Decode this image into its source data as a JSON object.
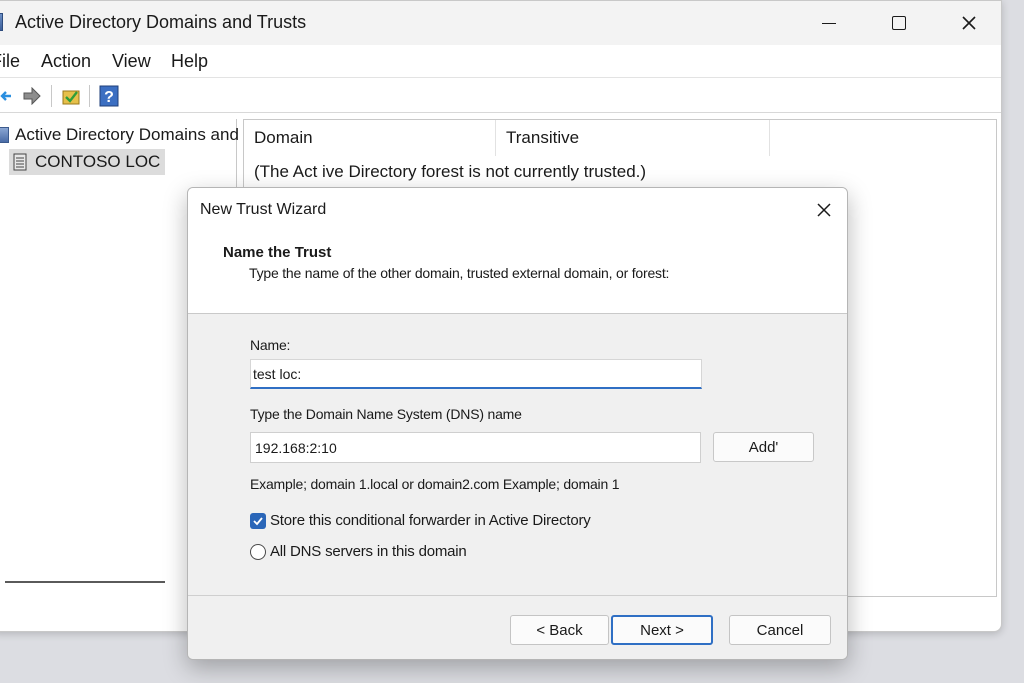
{
  "window": {
    "title": "Active Directory Domains and Trusts"
  },
  "menu": {
    "items": [
      "File",
      "Action",
      "View",
      "Help"
    ]
  },
  "tree": {
    "root_label": "Active Directory Domains and",
    "child_label": "CONTOSO LOC"
  },
  "list": {
    "columns": [
      "Domain",
      "Transitive"
    ],
    "empty_message": "(The Act ive Directory forest is not currently trusted.)"
  },
  "dialog": {
    "title": "New Trust Wizard",
    "step_title": "Name the Trust",
    "step_description": "Type the name of the other domain, trusted external domain, or forest:",
    "name_label": "Name:",
    "name_value": "test loc:",
    "dns_label": "Type the Domain Name System (DNS) name",
    "dns_value": "192.168:2:10",
    "add_label": "Add'",
    "example_text": "Example; domain 1.local or domain2.com Example; domain 1",
    "checkbox_label": "Store this conditional forwarder in Active Directory",
    "checkbox_checked": true,
    "radio_label": "All DNS servers in this domain",
    "radio_selected": false,
    "back_label": "< Back",
    "next_label": "Next >",
    "cancel_label": "Cancel"
  },
  "colors": {
    "accent": "#2f6fc4",
    "checkbox_fill": "#2a66b8",
    "dialog_bg": "#f0f0f0"
  },
  "icons": [
    "app-icon",
    "minimize-icon",
    "maximize-icon",
    "close-icon",
    "back-arrow-icon",
    "forward-arrow-icon",
    "properties-icon",
    "help-icon",
    "domain-tree-icon",
    "server-icon",
    "dialog-close-icon",
    "checkmark-icon"
  ]
}
